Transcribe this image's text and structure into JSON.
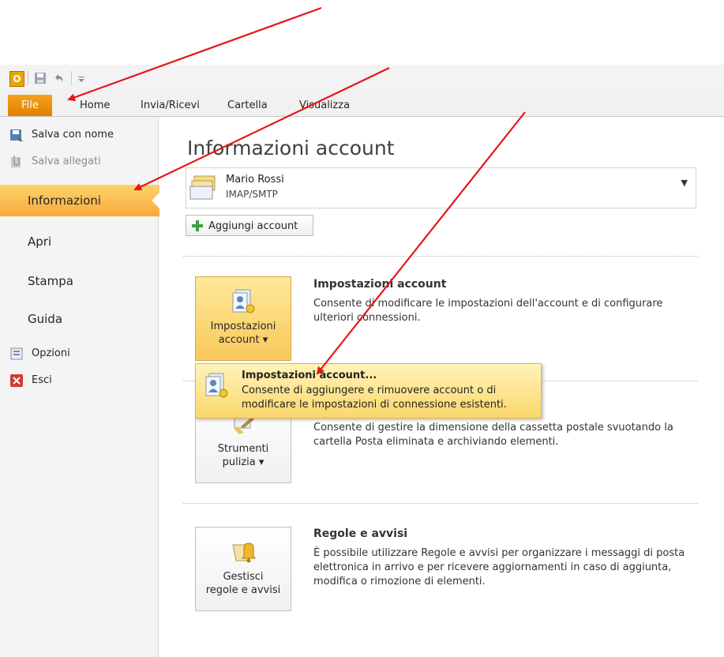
{
  "qat": {
    "logo_letter": "O",
    "icons": [
      "save-icon",
      "undo-icon",
      "customize-qat-icon"
    ]
  },
  "tabs": [
    "File",
    "Home",
    "Invia/Ricevi",
    "Cartella",
    "Visualizza"
  ],
  "nav": {
    "commands_top": [
      "Salva con nome",
      "Salva allegati"
    ],
    "items": [
      "Informazioni",
      "Apri",
      "Stampa",
      "Guida"
    ],
    "commands_bottom": [
      "Opzioni",
      "Esci"
    ]
  },
  "main": {
    "title": "Informazioni account",
    "account": {
      "name": "Mario Rossi",
      "type": "IMAP/SMTP"
    },
    "add_account": "Aggiungi account",
    "sections": [
      {
        "button_line1": "Impostazioni",
        "button_line2": "account ▾",
        "title": "Impostazioni account",
        "description": "Consente di modificare le impostazioni dell'account e di configurare ulteriori connessioni."
      },
      {
        "button_line1": "Strumenti",
        "button_line2": "pulizia ▾",
        "title": "",
        "description": "Consente di gestire la dimensione della cassetta postale svuotando la cartella Posta eliminata e archiviando elementi."
      },
      {
        "button_line1": "Gestisci",
        "button_line2": "regole e avvisi",
        "title": "Regole e avvisi",
        "description": "È possibile utilizzare Regole e avvisi per organizzare i messaggi di posta elettronica in arrivo e per ricevere aggiornamenti in caso di aggiunta, modifica o rimozione di elementi."
      }
    ]
  },
  "dropdown": {
    "title": "Impostazioni account...",
    "description": "Consente di aggiungere e rimuovere account o di modificare le impostazioni di connessione esistenti."
  },
  "colors": {
    "accent_orange": "#e07f00",
    "selection_gold": "#f8c85a",
    "annotation_red": "#e8141a"
  }
}
